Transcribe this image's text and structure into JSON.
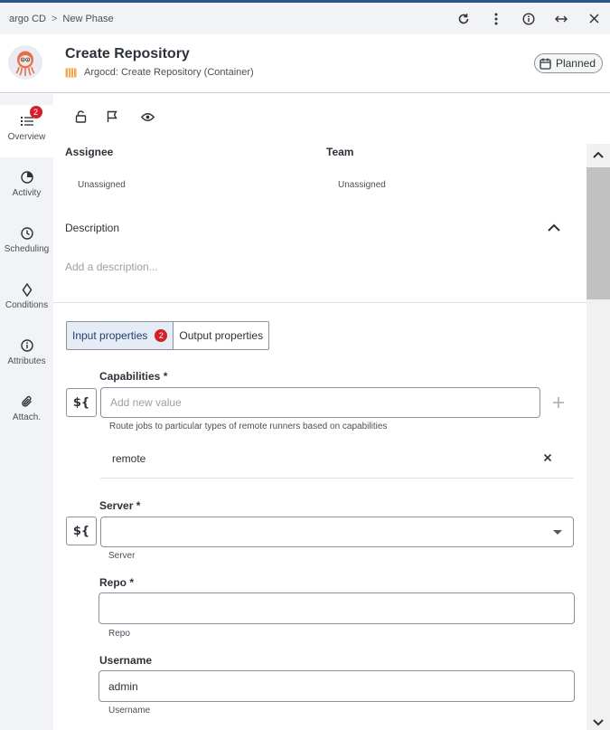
{
  "breadcrumb": {
    "root": "argo CD",
    "separator": ">",
    "current": "New Phase"
  },
  "top_icons": [
    "refresh-icon",
    "more-vertical-icon",
    "info-icon",
    "expand-horizontal-icon",
    "close-icon"
  ],
  "header": {
    "title": "Create Repository",
    "subtitle": "Argocd: Create Repository (Container)",
    "status": "Planned"
  },
  "nav": {
    "items": [
      {
        "label": "Overview",
        "icon": "list-icon",
        "badge": "2",
        "active": true
      },
      {
        "label": "Activity",
        "icon": "pie-icon"
      },
      {
        "label": "Scheduling",
        "icon": "clock-icon"
      },
      {
        "label": "Conditions",
        "icon": "diamond-icon"
      },
      {
        "label": "Attributes",
        "icon": "info-icon"
      },
      {
        "label": "Attach.",
        "icon": "paperclip-icon"
      }
    ]
  },
  "details": {
    "assignee_label": "Assignee",
    "assignee_value": "Unassigned",
    "team_label": "Team",
    "team_value": "Unassigned",
    "description_label": "Description",
    "description_placeholder": "Add a description..."
  },
  "tabs": {
    "input": "Input properties",
    "input_badge": "2",
    "output": "Output properties"
  },
  "form": {
    "variable_button": "${",
    "capabilities": {
      "label": "Capabilities *",
      "placeholder": "Add new value",
      "help": "Route jobs to particular types of remote runners based on capabilities",
      "values": [
        "remote"
      ]
    },
    "server": {
      "label": "Server *",
      "value": "",
      "help": "Server"
    },
    "repo": {
      "label": "Repo *",
      "value": "",
      "help": "Repo"
    },
    "username": {
      "label": "Username",
      "value": "admin",
      "help": "Username"
    }
  },
  "colors": {
    "accent": "#2f5487",
    "badge": "#d41f28",
    "active_tab": "#e6ecf5"
  }
}
